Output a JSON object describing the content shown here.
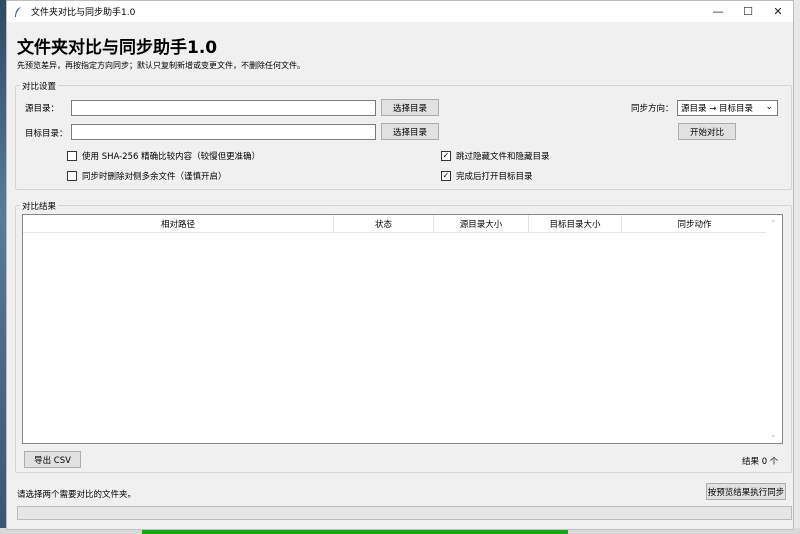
{
  "window": {
    "title": "文件夹对比与同步助手1.0",
    "minimize_glyph": "—",
    "maximize_glyph": "☐",
    "close_glyph": "✕",
    "icon": "feather-icon"
  },
  "header": {
    "title": "文件夹对比与同步助手1.0",
    "subtitle": "先预览差异，再按指定方向同步；默认只复制新增或变更文件，不删除任何文件。"
  },
  "settings": {
    "group_label": "对比设置",
    "source_label": "源目录：",
    "source_value": "",
    "target_label": "目标目录：",
    "target_value": "",
    "browse_source": "选择目录",
    "browse_target": "选择目录",
    "direction_label": "同步方向：",
    "direction_value": "源目录 → 目标目录",
    "start_button": "开始对比",
    "options": {
      "sha256": {
        "label": "使用 SHA-256 精确比较内容（较慢但更准确）",
        "checked": false
      },
      "skip_hidden": {
        "label": "跳过隐藏文件和隐藏目录",
        "checked": true
      },
      "delete_extra": {
        "label": "同步时删除对侧多余文件（谨慎开启）",
        "checked": false
      },
      "open_target": {
        "label": "完成后打开目标目录",
        "checked": true
      }
    }
  },
  "results": {
    "group_label": "对比结果",
    "columns": [
      "相对路径",
      "状态",
      "源目录大小",
      "目标目录大小",
      "同步动作"
    ],
    "rows": [],
    "export_button": "导出 CSV",
    "count_text": "结果 0 个"
  },
  "footer": {
    "status": "请选择两个需要对比的文件夹。",
    "sync_button": "按预览结果执行同步",
    "progress": 0
  },
  "colors": {
    "window_bg": "#f0f0f0",
    "titlebar_bg": "#ffffff",
    "button_bg": "#e1e1e1"
  }
}
